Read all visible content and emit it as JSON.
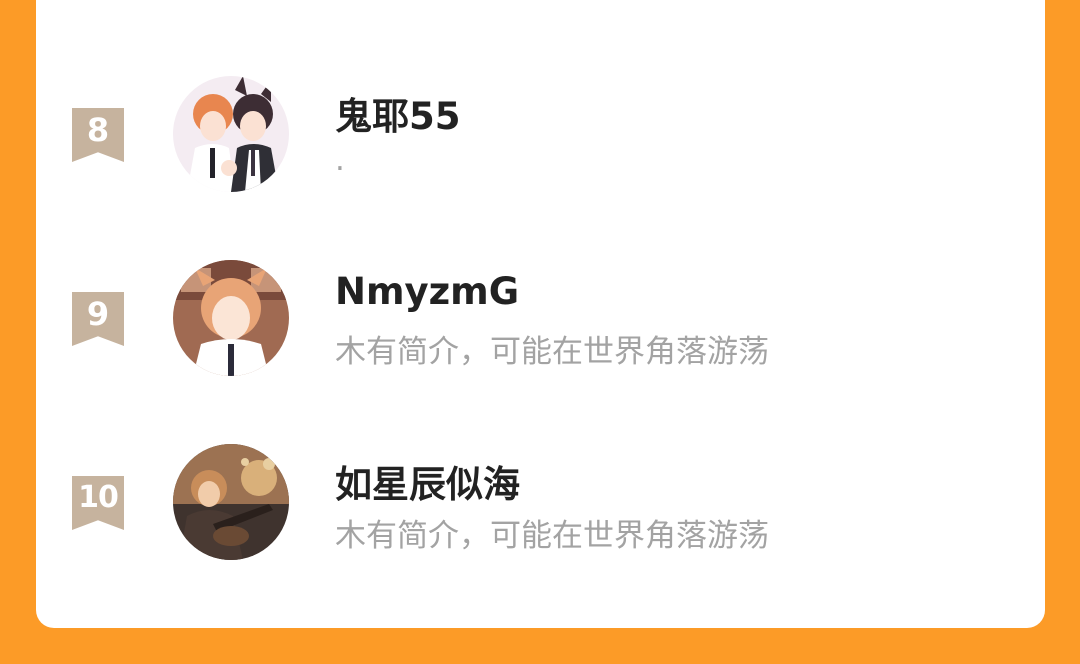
{
  "entries": [
    {
      "rank": "8",
      "name": "鬼耶55",
      "bio": "."
    },
    {
      "rank": "9",
      "name": "NmyzmG",
      "bio": "木有简介，可能在世界角落游荡"
    },
    {
      "rank": "10",
      "name": "如星辰似海",
      "bio": "木有简介，可能在世界角落游荡"
    }
  ],
  "colors": {
    "background": "#fc9b27",
    "card": "#ffffff",
    "rank_badge": "#c6b39e",
    "name_text": "#222222",
    "bio_text": "#a3a3a3"
  }
}
